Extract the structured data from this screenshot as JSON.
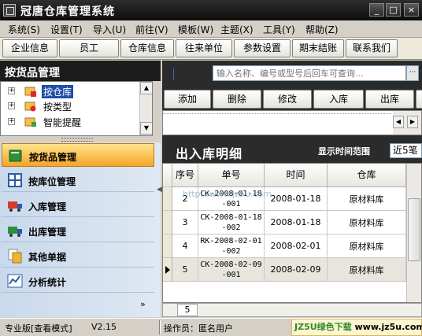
{
  "window": {
    "title": "冠唐仓库管理系统",
    "buttons": [
      "_",
      "□",
      "×"
    ]
  },
  "menu": [
    "系统(S)",
    "设置(T)",
    "导入(U)",
    "前往(V)",
    "模板(W)",
    "主题(X)",
    "工具(Y)",
    "帮助(Z)"
  ],
  "toolbar": [
    "企业信息",
    "员工",
    "仓库信息",
    "往来单位",
    "参数设置",
    "期末结账",
    "联系我们"
  ],
  "left_panel": {
    "header": "按货品管理",
    "tree": [
      {
        "label": "按仓库",
        "selected": true,
        "icon": "warehouse-icon"
      },
      {
        "label": "按类型",
        "selected": false,
        "icon": "category-icon"
      },
      {
        "label": "智能提醒",
        "selected": false,
        "icon": "alert-icon"
      }
    ],
    "nav": [
      {
        "label": "按货品管理",
        "icon": "book-icon",
        "active": true
      },
      {
        "label": "按库位管理",
        "icon": "grid-icon",
        "active": false
      },
      {
        "label": "入库管理",
        "icon": "truck-in-icon",
        "active": false
      },
      {
        "label": "出库管理",
        "icon": "truck-out-icon",
        "active": false
      },
      {
        "label": "其他单据",
        "icon": "documents-icon",
        "active": false
      },
      {
        "label": "分析统计",
        "icon": "chart-icon",
        "active": false
      }
    ],
    "nav_more": "»"
  },
  "search": {
    "placeholder": "输入名称、编号或型号后回车可查询..."
  },
  "actions": [
    "添加",
    "删除",
    "修改",
    "入库",
    "出库"
  ],
  "section": {
    "title": "出入库明细",
    "range_label": "显示时间范围",
    "range_value": "近5笔"
  },
  "table": {
    "headers": [
      "序号",
      "单号",
      "时间",
      "仓库"
    ],
    "rows": [
      {
        "no": "2",
        "code1": "CK-2008-01-18",
        "code2": "-001",
        "date": "2008-01-18",
        "warehouse": "原材料库",
        "current": false
      },
      {
        "no": "3",
        "code1": "CK-2008-01-18",
        "code2": "-002",
        "date": "2008-01-18",
        "warehouse": "原材料库",
        "current": false
      },
      {
        "no": "4",
        "code1": "RK-2008-02-01",
        "code2": "-002",
        "date": "2008-02-01",
        "warehouse": "原材料库",
        "current": false
      },
      {
        "no": "5",
        "code1": "CK-2008-02-09",
        "code2": "-001",
        "date": "2008-02-09",
        "warehouse": "原材料库",
        "current": true
      }
    ],
    "count": "5"
  },
  "overlay_url": "http://www.jz5u.com",
  "status": {
    "edition": "专业版[查看模式]",
    "version": "V2.15",
    "operator": "操作员：匿名用户",
    "watermark_green": "JZ5U绿色下载",
    "watermark_url": "www.jz5u.com"
  },
  "colors": {
    "title_bar": "#1a1a1a",
    "nav_active": "#f4a52c",
    "selection": "#1e4fa8"
  }
}
